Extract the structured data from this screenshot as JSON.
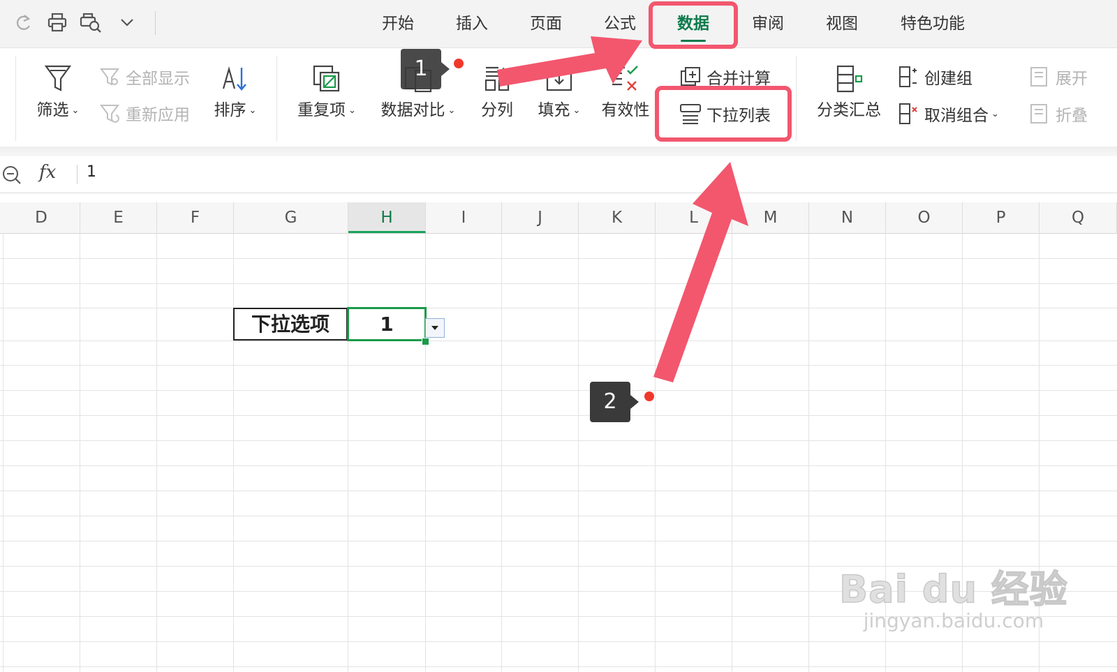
{
  "tabs": [
    {
      "label": "开始",
      "active": false
    },
    {
      "label": "插入",
      "active": false
    },
    {
      "label": "页面",
      "active": false
    },
    {
      "label": "公式",
      "active": false
    },
    {
      "label": "数据",
      "active": true
    },
    {
      "label": "审阅",
      "active": false
    },
    {
      "label": "视图",
      "active": false
    },
    {
      "label": "特色功能",
      "active": false
    }
  ],
  "ribbon": {
    "filter": "筛选",
    "show_all": "全部显示",
    "reapply": "重新应用",
    "sort": "排序",
    "duplicates": "重复项",
    "compare": "数据对比",
    "split": "分列",
    "fill": "填充",
    "validity": "有效性",
    "consolidate": "合并计算",
    "dropdown_list": "下拉列表",
    "subtotal": "分类汇总",
    "group": "创建组",
    "ungroup": "取消组合",
    "expand": "展开",
    "collapse": "折叠"
  },
  "formula_bar": {
    "fx": "fx",
    "value": "1"
  },
  "columns": [
    "D",
    "E",
    "F",
    "G",
    "H",
    "I",
    "J",
    "K",
    "L",
    "M",
    "N",
    "O",
    "P",
    "Q"
  ],
  "selected_column": "H",
  "cells": {
    "label": "下拉选项",
    "value": "1"
  },
  "annotations": {
    "step1": "1",
    "step2": "2"
  },
  "watermark": {
    "main": "Bai du 经验",
    "sub": "jingyan.baidu.com"
  },
  "colors": {
    "accent": "#0f7b4b",
    "highlight": "#f2576e",
    "cell_border": "#1a9a4a",
    "dot": "#f0382b"
  }
}
